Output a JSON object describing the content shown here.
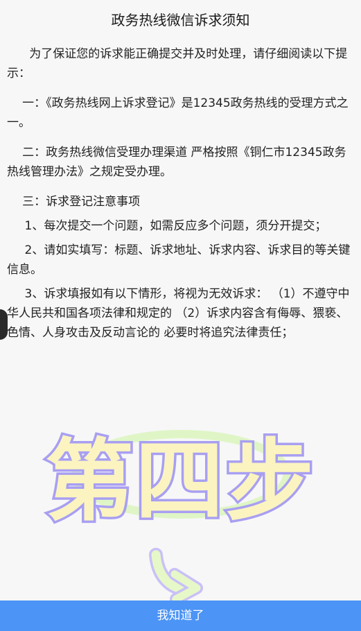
{
  "page": {
    "title": "政务热线微信诉求须知"
  },
  "notice": {
    "intro": "为了保证您的诉求能正确提交并及时处理，请仔细阅读以下提示：",
    "item1": "一：《政务热线网上诉求登记》是12345政务热线的受理方式之一。",
    "item2": "二：政务热线微信受理办理渠道 严格按照《铜仁市12345政务热线管理办法》之规定受办理。",
    "item3": "三：诉求登记注意事项",
    "sub1": "1、每次提交一个问题，如需反应多个问题，须分开提交；",
    "sub2": "2、请如实填写：标题、诉求地址、诉求内容、诉求目的等关键信息。",
    "sub3": "3、诉求填报如有以下情形，将视为无效诉求： （1）不遵守中华人民共和国各项法律和规定的 （2）诉求内容含有侮辱、猥亵、色情、人身攻击及反动言论的 必要时将追究法律责任；"
  },
  "overlay": {
    "text": "第四步",
    "fill_color": "#fbf4c0",
    "stroke_color": "#a89ff2",
    "oval_color": "#dff5c6",
    "arrow_color": "#e6f8c8",
    "arrow_icon": "curved-arrow-down-icon"
  },
  "footer": {
    "confirm_label": "我知道了",
    "button_color": "#4c94f5"
  }
}
